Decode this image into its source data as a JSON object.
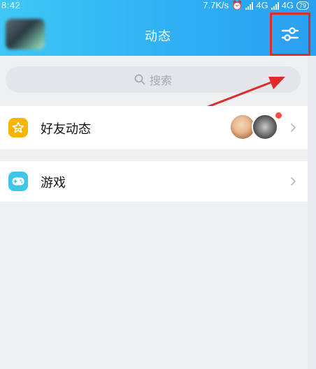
{
  "status_bar": {
    "time": "8:42",
    "network_speed": "7.7K/s",
    "network_type_1": "4G",
    "network_type_2": "4G",
    "battery_level": "79"
  },
  "header": {
    "title": "动态",
    "settings_icon": "sliders-icon"
  },
  "search": {
    "placeholder": "搜索",
    "icon": "search-icon"
  },
  "feed_items": [
    {
      "label": "好友动态",
      "icon": "star-icon",
      "icon_color": "#f7b500",
      "has_new": true
    },
    {
      "label": "游戏",
      "icon": "gamepad-icon",
      "icon_color": "#3ec6e8"
    }
  ],
  "colors": {
    "header_gradient_start": "#3fc8f5",
    "header_gradient_end": "#2a9ff2",
    "highlight_box": "#e12a2a",
    "annotation_arrow": "#e12a2a",
    "notification_dot": "#ff4d3d",
    "page_background": "#eef0f2"
  }
}
